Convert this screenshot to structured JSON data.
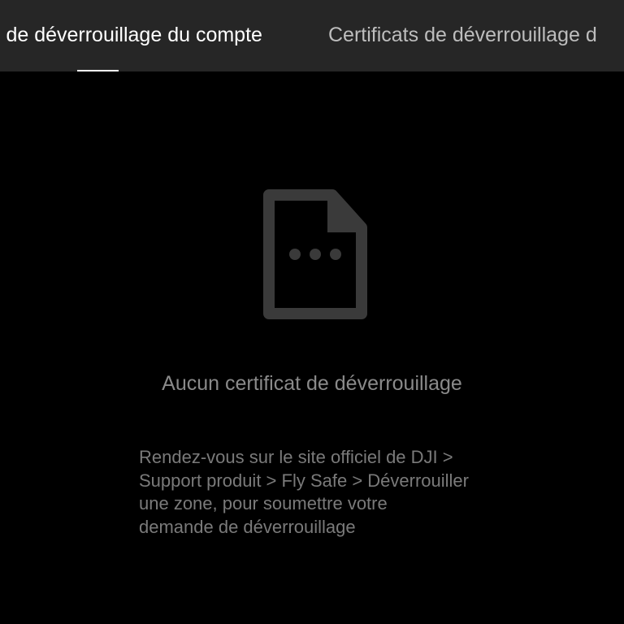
{
  "tabs": [
    {
      "label": "Certificats de déverrouillage du compte",
      "visible_text": "s de déverrouillage du compte",
      "active": true
    },
    {
      "label": "Certificats de déverrouillage de l'appareil",
      "visible_text": "Certificats de déverrouillage d",
      "active": false
    }
  ],
  "empty_state": {
    "icon": "document-pending-icon",
    "title": "Aucun certificat de déverrouillage",
    "hint_lines": [
      "Rendez-vous sur le site officiel de DJI >",
      "Support produit > Fly Safe > Déverrouiller",
      "une zone, pour soumettre votre",
      "demande de déverrouillage"
    ]
  },
  "colors": {
    "background": "#000000",
    "tabbar": "#262626",
    "active_tab_text": "#ffffff",
    "inactive_tab_text": "#bdbdbd",
    "icon": "#3a3a3a",
    "title_text": "#8a8a8a",
    "hint_text": "#7a7a7a"
  }
}
